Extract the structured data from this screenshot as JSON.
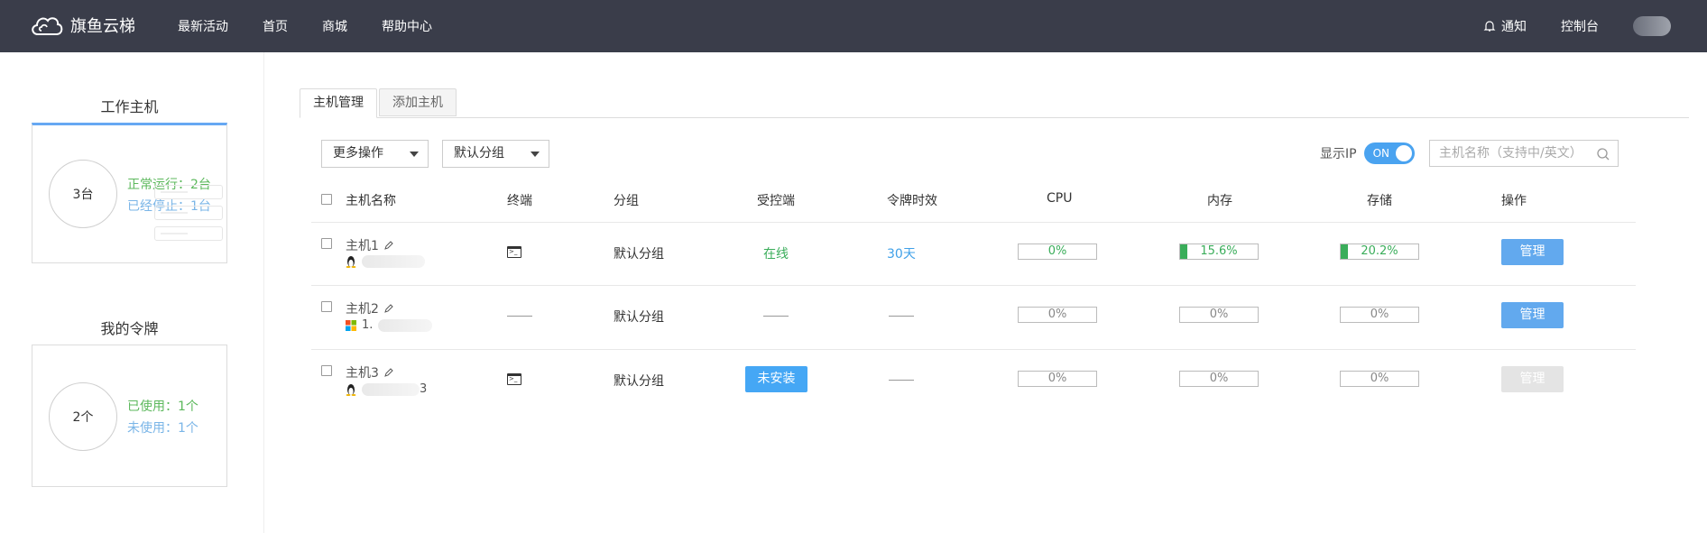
{
  "brand": {
    "name": "旗鱼云梯",
    "logo_icon": "cloud-logo-icon"
  },
  "nav": {
    "items": [
      "最新活动",
      "首页",
      "商城",
      "帮助中心"
    ]
  },
  "header_right": {
    "notify": "通知",
    "console": "控制台"
  },
  "sidebar": {
    "work_hosts": {
      "title": "工作主机",
      "count": "3台",
      "running": "正常运行：2台",
      "stopped": "已经停止：1台"
    },
    "tokens": {
      "title": "我的令牌",
      "count": "2个",
      "used": "已使用：1个",
      "unused": "未使用：1个"
    }
  },
  "tabs": [
    "主机管理",
    "添加主机"
  ],
  "toolbar": {
    "more_ops": "更多操作",
    "default_group": "默认分组",
    "show_ip_label": "显示IP",
    "toggle_label": "ON",
    "search_placeholder": "主机名称（支持中/英文）"
  },
  "table": {
    "headers": [
      "主机名称",
      "终端",
      "分组",
      "受控端",
      "令牌时效",
      "CPU",
      "内存",
      "存储",
      "操作"
    ],
    "rows": [
      {
        "name": "主机1",
        "os": "linux",
        "sub_prefix": "",
        "terminal": true,
        "group": "默认分组",
        "agent": "在线",
        "agent_type": "online",
        "token": "30天",
        "cpu": "0%",
        "cpu_fraction": 0,
        "mem": "15.6%",
        "mem_fraction": 0.156,
        "disk": "20.2%",
        "disk_fraction": 0.202,
        "action": "管理",
        "action_enabled": true
      },
      {
        "name": "主机2",
        "os": "windows",
        "sub_prefix": "1.",
        "terminal": false,
        "group": "默认分组",
        "agent": "",
        "agent_type": "none",
        "token": "",
        "cpu": "0%",
        "cpu_fraction": 0,
        "mem": "0%",
        "mem_fraction": 0,
        "disk": "0%",
        "disk_fraction": 0,
        "action": "管理",
        "action_enabled": true
      },
      {
        "name": "主机3",
        "os": "linux",
        "sub_prefix": "",
        "sub_suffix": "3",
        "terminal": true,
        "group": "默认分组",
        "agent": "未安装",
        "agent_type": "not-installed",
        "token": "",
        "cpu": "0%",
        "cpu_fraction": 0,
        "mem": "0%",
        "mem_fraction": 0,
        "disk": "0%",
        "disk_fraction": 0,
        "action": "管理",
        "action_enabled": false
      }
    ]
  },
  "colors": {
    "nav_bg": "#3a3d4a",
    "accent_blue": "#4aa3f0",
    "green": "#3aad5a",
    "button_blue": "#62a9ee"
  }
}
